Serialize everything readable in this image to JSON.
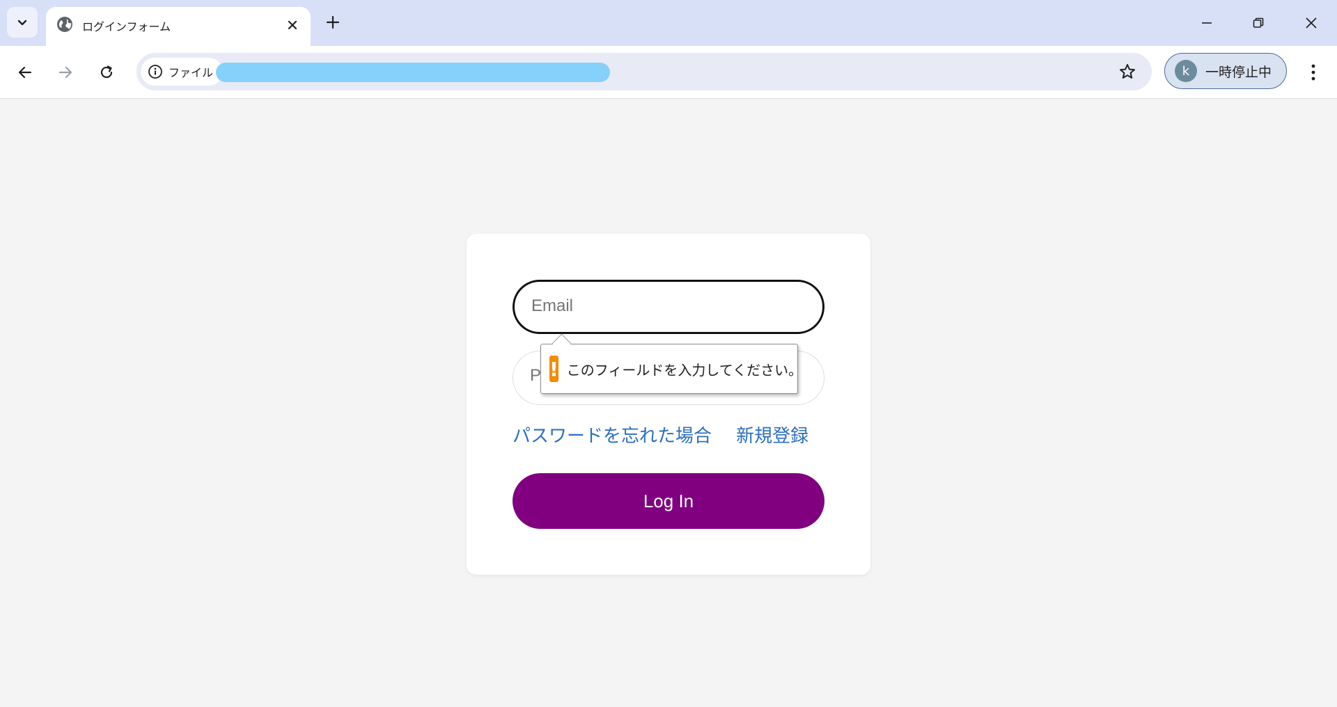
{
  "browser": {
    "tab": {
      "title": "ログインフォーム"
    },
    "omnibox": {
      "site_chip_label": "ファイル"
    },
    "profile": {
      "avatar_letter": "k",
      "label": "一時停止中"
    }
  },
  "form": {
    "email": {
      "placeholder": "Email",
      "value": ""
    },
    "password": {
      "placeholder": "P",
      "value": ""
    },
    "links": {
      "forgot_password": "パスワードを忘れた場合",
      "register": "新規登録"
    },
    "login_button": "Log In"
  },
  "validation_tooltip": {
    "icon": "!",
    "message": "このフィールドを入力してください。"
  },
  "colors": {
    "primary_button": "#800080",
    "link": "#2a6ebf",
    "warning": "#f48c06",
    "tabstrip": "#d8e0f8",
    "page_background": "#f4f4f4"
  }
}
